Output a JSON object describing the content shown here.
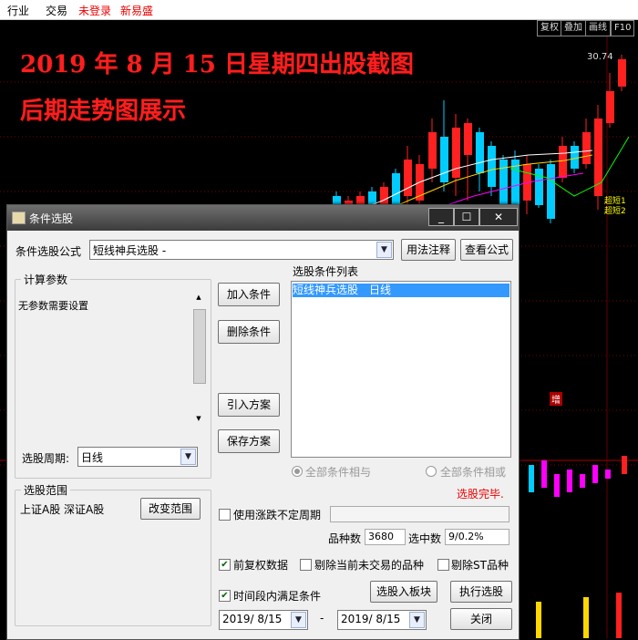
{
  "menu": {
    "industry": "行业",
    "trade": "交易",
    "login": "未登录",
    "brand": "新易盛"
  },
  "toolbar": {
    "fuquan": "复权",
    "diejia": "叠加",
    "huaxian": "画线",
    "f10": "F10"
  },
  "overlay": {
    "line1": "2019 年 8 月 15 日星期四出股截图",
    "line2": "后期走势图展示"
  },
  "chart": {
    "price_label": "30.74",
    "signal1": "超短1",
    "signal2": "超短2",
    "zeng": "增"
  },
  "colors": {
    "up": "#ff2020",
    "down": "#00ccff",
    "overlay": "#ff1e1e"
  },
  "dialog": {
    "title": "条件选股",
    "formula_label": "条件选股公式",
    "formula_value": "短线神兵选股 -",
    "usage_btn": "用法注释",
    "view_btn": "查看公式",
    "params_group": "计算参数",
    "params_text": "无参数需要设置",
    "period_label": "选股周期:",
    "period_value": "日线",
    "add_btn": "加入条件",
    "delete_btn": "删除条件",
    "import_btn": "引入方案",
    "save_btn": "保存方案",
    "list_label": "选股条件列表",
    "list_items": [
      {
        "name": "短线神兵选股",
        "period": "日线"
      }
    ],
    "radio_and": "全部条件相与",
    "radio_or": "全部条件相或",
    "status": "选股完毕.",
    "scope_group": "选股范围",
    "scope_text": "上证A股 深证A股",
    "change_scope_btn": "改变范围",
    "opt_irregular": "使用涨跌不定周期",
    "count_label": "品种数",
    "count_value": "3680",
    "selected_label": "选中数",
    "selected_value": "9/0.2%",
    "opt_fuquan": "前复权数据",
    "opt_exclude_notrade": "剔除当前未交易的品种",
    "opt_exclude_st": "剔除ST品种",
    "opt_timerange": "时间段内满足条件",
    "to_block_btn": "选股入板块",
    "execute_btn": "执行选股",
    "date_from": "2019/ 8/15",
    "date_sep": "-",
    "date_to": "2019/ 8/15",
    "close_btn": "关闭"
  }
}
